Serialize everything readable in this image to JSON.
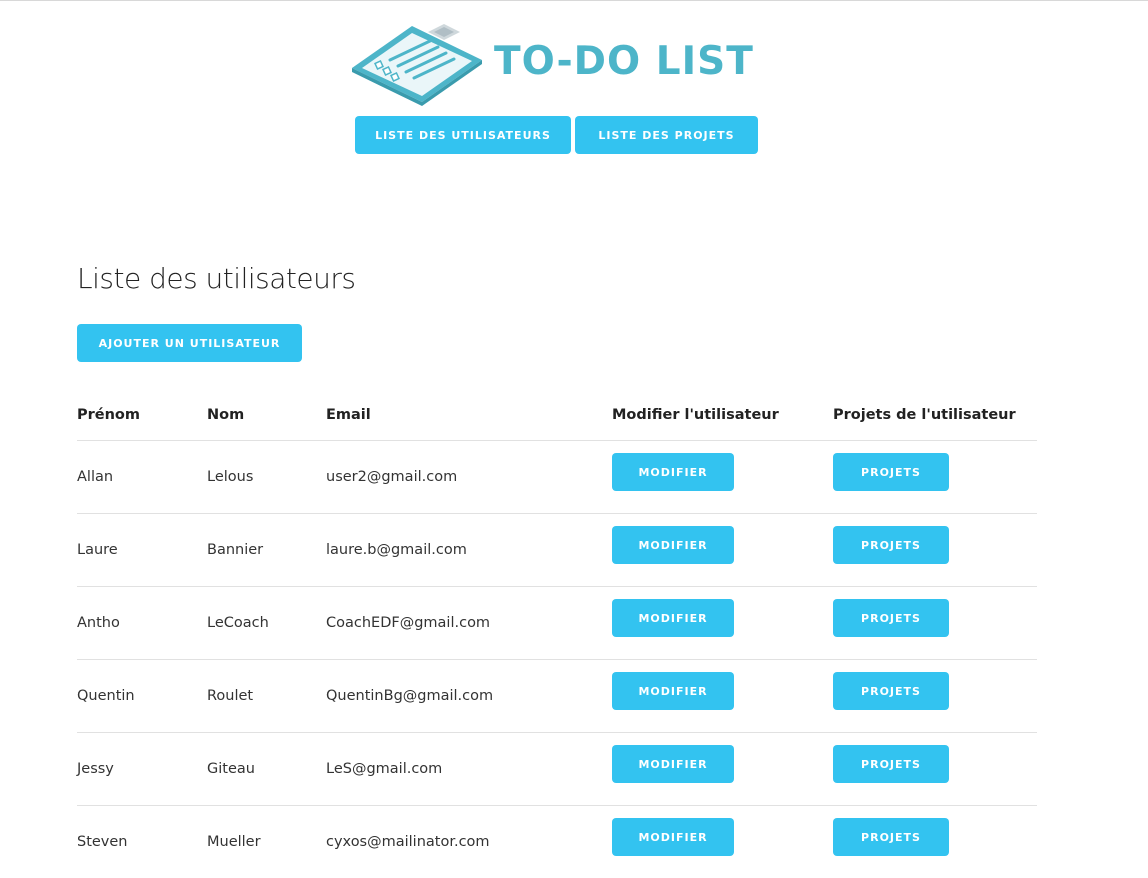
{
  "brand": {
    "title": "TO-DO LIST",
    "accent_color": "#4db5c9",
    "button_color": "#33c3f0",
    "icon": "clipboard-checklist-icon"
  },
  "nav": {
    "users_label": "LISTE DES UTILISATEURS",
    "projects_label": "LISTE DES PROJETS"
  },
  "page": {
    "title": "Liste des utilisateurs",
    "add_button": "AJOUTER UN UTILISATEUR"
  },
  "table": {
    "headers": [
      "Prénom",
      "Nom",
      "Email",
      "Modifier l'utilisateur",
      "Projets de l'utilisateur"
    ],
    "rows": [
      {
        "firstname": "Allan",
        "lastname": "Lelous",
        "email": "user2@gmail.com",
        "modify_label": "MODIFIER",
        "projects_label": "PROJETS"
      },
      {
        "firstname": "Laure",
        "lastname": "Bannier",
        "email": "laure.b@gmail.com",
        "modify_label": "MODIFIER",
        "projects_label": "PROJETS"
      },
      {
        "firstname": "Antho",
        "lastname": "LeCoach",
        "email": "CoachEDF@gmail.com",
        "modify_label": "MODIFIER",
        "projects_label": "PROJETS"
      },
      {
        "firstname": "Quentin",
        "lastname": "Roulet",
        "email": "QuentinBg@gmail.com",
        "modify_label": "MODIFIER",
        "projects_label": "PROJETS"
      },
      {
        "firstname": "Jessy",
        "lastname": "Giteau",
        "email": "LeS@gmail.com",
        "modify_label": "MODIFIER",
        "projects_label": "PROJETS"
      },
      {
        "firstname": "Steven",
        "lastname": "Mueller",
        "email": "cyxos@mailinator.com",
        "modify_label": "MODIFIER",
        "projects_label": "PROJETS"
      }
    ]
  }
}
